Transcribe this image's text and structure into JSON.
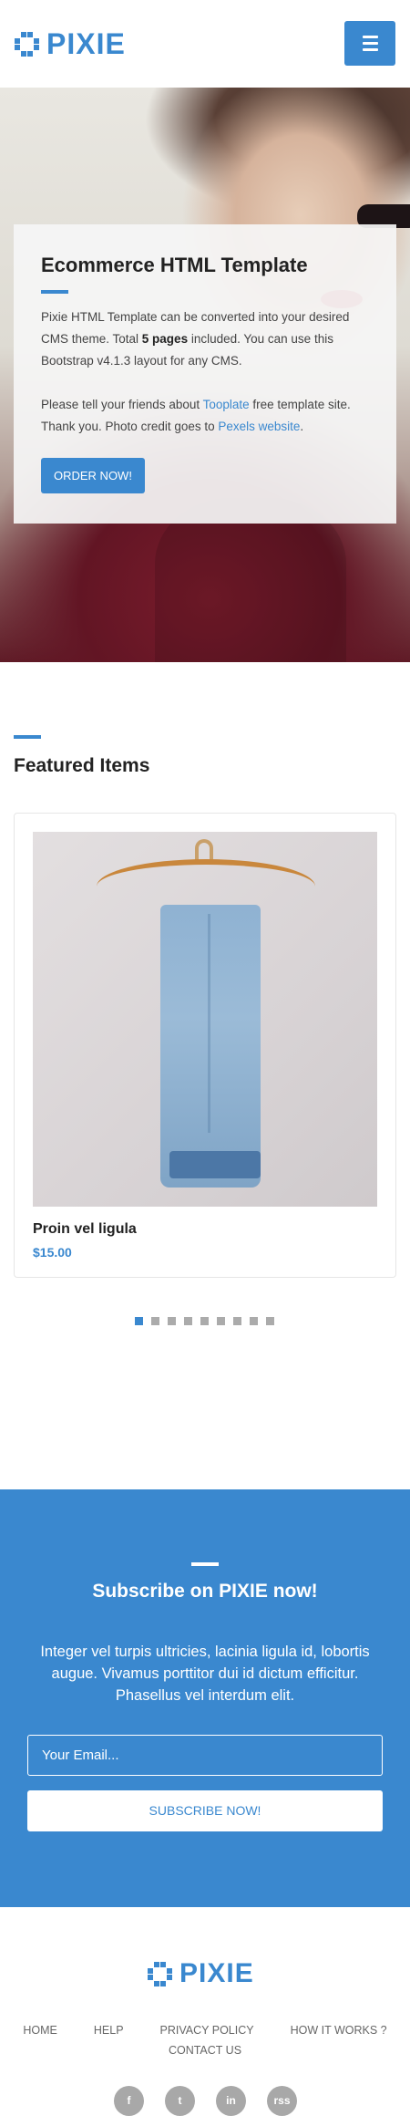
{
  "header": {
    "logo_text": "PIXIE",
    "menu_icon": "hamburger-menu-icon"
  },
  "hero": {
    "title": "Ecommerce HTML Template",
    "p1_a": "Pixie HTML Template can be converted into your desired CMS theme. Total ",
    "p1_bold": "5 pages",
    "p1_b": " included. You can use this Bootstrap v4.1.3 layout for any CMS.",
    "p2_a": "Please tell your friends about ",
    "p2_link1": "Tooplate",
    "p2_b": " free template site. Thank you. Photo credit goes to ",
    "p2_link2": "Pexels website",
    "p2_c": ".",
    "button_label": "ORDER NOW!"
  },
  "featured": {
    "title": "Featured Items",
    "product": {
      "name": "Proin vel ligula",
      "price": "$15.00"
    },
    "carousel": {
      "count": 9,
      "active_index": 0
    }
  },
  "subscribe": {
    "title": "Subscribe on PIXIE now!",
    "text": "Integer vel turpis ultricies, lacinia ligula id, lobortis augue. Vivamus porttitor dui id dictum efficitur. Phasellus vel interdum elit.",
    "email_placeholder": "Your Email...",
    "button_label": "SUBSCRIBE NOW!"
  },
  "footer": {
    "logo_text": "PIXIE",
    "nav": [
      "HOME",
      "HELP",
      "PRIVACY POLICY",
      "HOW IT WORKS ?",
      "CONTACT US"
    ],
    "social": [
      {
        "icon": "facebook-icon",
        "glyph": "f"
      },
      {
        "icon": "twitter-icon",
        "glyph": "t"
      },
      {
        "icon": "linkedin-icon",
        "glyph": "in"
      },
      {
        "icon": "rss-icon",
        "glyph": "rss"
      }
    ]
  },
  "colors": {
    "accent": "#3a88cf",
    "text_dark": "#222222",
    "social_gray": "#a8a8a8"
  }
}
